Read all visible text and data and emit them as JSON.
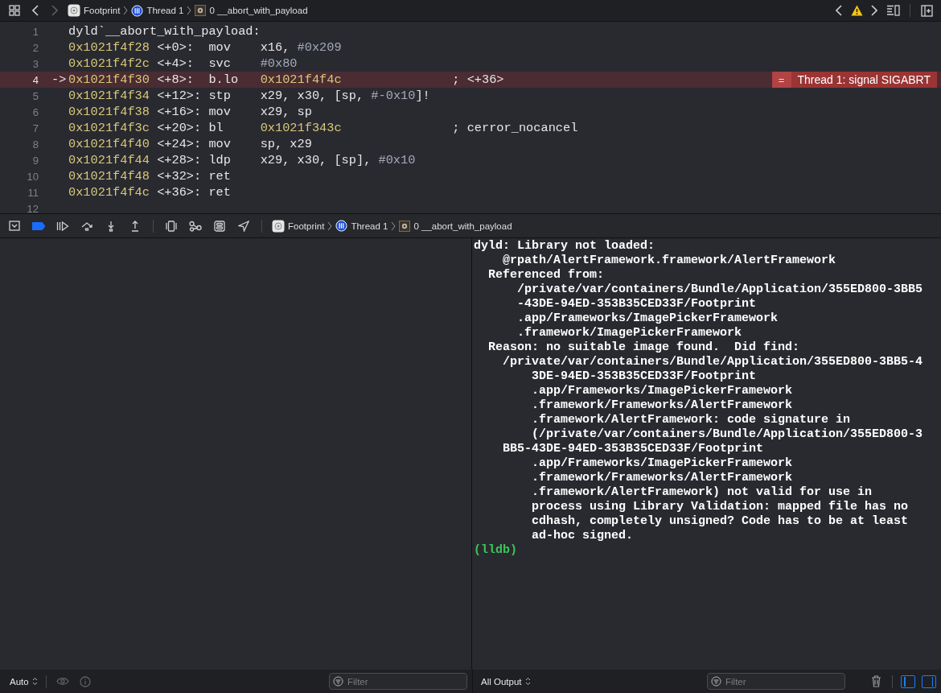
{
  "jump_bar": {
    "nav": [
      {
        "kind": "back",
        "disabled": false
      },
      {
        "kind": "forward",
        "disabled": true
      }
    ],
    "breadcrumbs": [
      {
        "kind": "app",
        "label": "Footprint"
      },
      {
        "kind": "thread",
        "label": "Thread 1"
      },
      {
        "kind": "frame",
        "label": "0 __abort_with_payload"
      }
    ]
  },
  "editor": {
    "lines": [
      {
        "kind": "label",
        "number": "1",
        "text": "dyld`__abort_with_payload:",
        "current": false
      },
      {
        "kind": "instruction",
        "number": "2",
        "address": "0x1021f4f28",
        "offset": "<+0>:",
        "mnemonic": "mov",
        "operands": [
          {
            "kind": "reg",
            "text": "x16, "
          },
          {
            "kind": "imm",
            "text": "#0x209"
          }
        ],
        "current": false
      },
      {
        "kind": "instruction",
        "number": "3",
        "address": "0x1021f4f2c",
        "offset": "<+4>:",
        "mnemonic": "svc",
        "operands": [
          {
            "kind": "imm",
            "text": "#0x80"
          }
        ],
        "current": false
      },
      {
        "kind": "instruction",
        "number": "4",
        "arrow": "->",
        "address": "0x1021f4f30",
        "offset": "<+8>:",
        "mnemonic": "b.lo",
        "operands": [
          {
            "kind": "addr",
            "text": "0x1021f4f4c"
          }
        ],
        "comment": "; <+36>",
        "current": true,
        "annotation": {
          "icon": "=",
          "text": "Thread 1: signal SIGABRT"
        }
      },
      {
        "kind": "instruction",
        "number": "5",
        "address": "0x1021f4f34",
        "offset": "<+12>:",
        "mnemonic": "stp",
        "operands": [
          {
            "kind": "reg",
            "text": "x29, x30, [sp, "
          },
          {
            "kind": "imm",
            "text": "#-0x10"
          },
          {
            "kind": "reg",
            "text": "]!"
          }
        ],
        "current": false
      },
      {
        "kind": "instruction",
        "number": "6",
        "address": "0x1021f4f38",
        "offset": "<+16>:",
        "mnemonic": "mov",
        "operands": [
          {
            "kind": "reg",
            "text": "x29, sp"
          }
        ],
        "current": false
      },
      {
        "kind": "instruction",
        "number": "7",
        "address": "0x1021f4f3c",
        "offset": "<+20>:",
        "mnemonic": "bl",
        "operands": [
          {
            "kind": "addr",
            "text": "0x1021f343c"
          }
        ],
        "comment": "; cerror_nocancel",
        "current": false
      },
      {
        "kind": "instruction",
        "number": "8",
        "address": "0x1021f4f40",
        "offset": "<+24>:",
        "mnemonic": "mov",
        "operands": [
          {
            "kind": "reg",
            "text": "sp, x29"
          }
        ],
        "current": false
      },
      {
        "kind": "instruction",
        "number": "9",
        "address": "0x1021f4f44",
        "offset": "<+28>:",
        "mnemonic": "ldp",
        "operands": [
          {
            "kind": "reg",
            "text": "x29, x30, [sp], "
          },
          {
            "kind": "imm",
            "text": "#0x10"
          }
        ],
        "current": false
      },
      {
        "kind": "instruction",
        "number": "10",
        "address": "0x1021f4f48",
        "offset": "<+32>:",
        "mnemonic": "ret",
        "current": false
      },
      {
        "kind": "instruction",
        "number": "11",
        "address": "0x1021f4f4c",
        "offset": "<+36>:",
        "mnemonic": "ret",
        "current": false
      },
      {
        "kind": "empty",
        "number": "12",
        "current": false
      }
    ]
  },
  "debug_bar": {
    "breakpoints_active": true,
    "breadcrumbs": [
      {
        "kind": "app",
        "label": "Footprint"
      },
      {
        "kind": "thread",
        "label": "Thread 1"
      },
      {
        "kind": "frame",
        "label": "0 __abort_with_payload"
      }
    ]
  },
  "console": {
    "lines": [
      {
        "kind": "text",
        "text": "dyld: Library not loaded:"
      },
      {
        "kind": "text",
        "text": "    @rpath/AlertFramework.framework/AlertFramework"
      },
      {
        "kind": "text",
        "text": "  Referenced from:"
      },
      {
        "kind": "text",
        "text": "      /private/var/containers/Bundle/Application/355ED800-3BB5"
      },
      {
        "kind": "text",
        "text": "      -43DE-94ED-353B35CED33F/Footprint"
      },
      {
        "kind": "text",
        "text": "      .app/Frameworks/ImagePickerFramework"
      },
      {
        "kind": "text",
        "text": "      .framework/ImagePickerFramework"
      },
      {
        "kind": "text",
        "text": "  Reason: no suitable image found.  Did find:"
      },
      {
        "kind": "text",
        "text": "    /private/var/containers/Bundle/Application/355ED800-3BB5-4"
      },
      {
        "kind": "text",
        "text": "        3DE-94ED-353B35CED33F/Footprint"
      },
      {
        "kind": "text",
        "text": "        .app/Frameworks/ImagePickerFramework"
      },
      {
        "kind": "text",
        "text": "        .framework/Frameworks/AlertFramework"
      },
      {
        "kind": "text",
        "text": "        .framework/AlertFramework: code signature in"
      },
      {
        "kind": "text",
        "text": "        (/private/var/containers/Bundle/Application/355ED800-3"
      },
      {
        "kind": "text",
        "text": "    BB5-43DE-94ED-353B35CED33F/Footprint"
      },
      {
        "kind": "text",
        "text": "        .app/Frameworks/ImagePickerFramework"
      },
      {
        "kind": "text",
        "text": "        .framework/Frameworks/AlertFramework"
      },
      {
        "kind": "text",
        "text": "        .framework/AlertFramework) not valid for use in"
      },
      {
        "kind": "text",
        "text": "        process using Library Validation: mapped file has no"
      },
      {
        "kind": "text",
        "text": "        cdhash, completely unsigned? Code has to be at least"
      },
      {
        "kind": "text",
        "text": "        ad-hoc signed."
      },
      {
        "kind": "prompt",
        "text": "(lldb)"
      }
    ]
  },
  "variables_footer": {
    "scope": "Auto",
    "filter": {
      "placeholder": "Filter"
    }
  },
  "console_footer": {
    "scope": "All Output",
    "filter": {
      "placeholder": "Filter"
    },
    "panels": [
      {
        "kind": "variables",
        "on": true
      },
      {
        "kind": "console",
        "on": true
      }
    ]
  }
}
